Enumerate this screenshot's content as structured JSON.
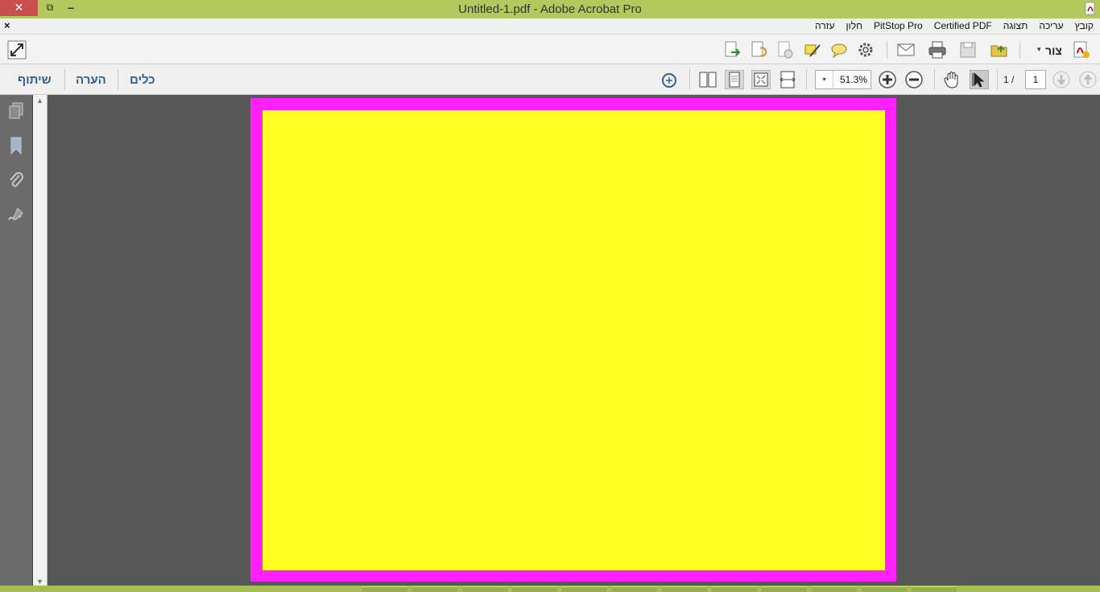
{
  "window": {
    "title": "Untitled-1.pdf - Adobe Acrobat Pro",
    "close_glyph": "✕",
    "restore_glyph": "⧉",
    "minimize_glyph": "–"
  },
  "menu": {
    "close_doc_glyph": "×",
    "items": [
      "קובץ",
      "עריכה",
      "תצוגה",
      "Certified PDF",
      "PitStop Pro",
      "חלון",
      "עזרה"
    ]
  },
  "toolbar": {
    "create_label": "צור",
    "create_arrow": "▾"
  },
  "navbar": {
    "tools_label": "כלים",
    "comment_label": "הערה",
    "share_label": "שיתוף",
    "zoom_value": "51.3%",
    "zoom_arrow": "▾",
    "page_number": "1",
    "page_total": "1 /"
  },
  "scrollbar": {
    "up_glyph": "▲",
    "down_glyph": "▼"
  },
  "colors": {
    "titlebar": "#b3c95d",
    "close_button": "#c94f4f",
    "page_border": "#ff20ff",
    "page_fill": "#fffd22",
    "workspace": "#575757"
  }
}
